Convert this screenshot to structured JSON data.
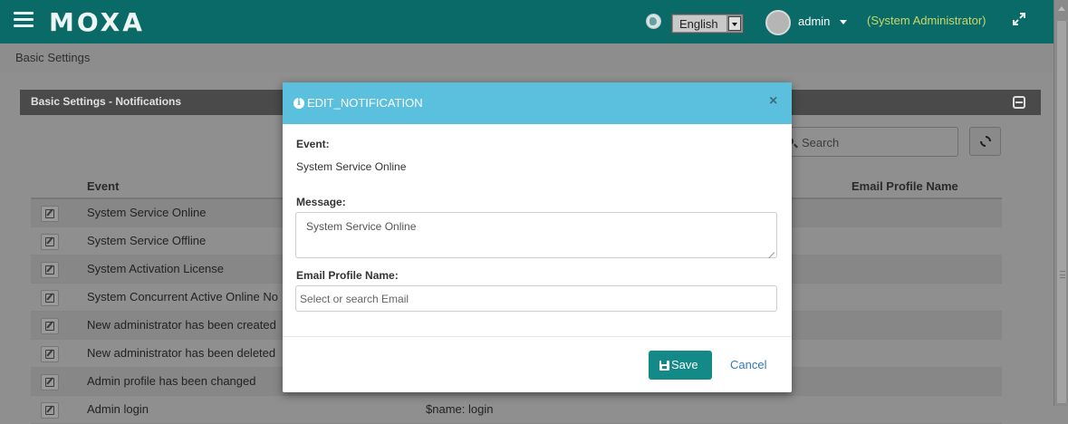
{
  "header": {
    "logo": "MOXA",
    "language": "English",
    "user": "admin",
    "role": "(System Administrator)"
  },
  "breadcrumb": "Basic Settings",
  "panel": {
    "title": "Basic Settings - Notifications",
    "search_placeholder": "Search",
    "columns": {
      "event": "Event",
      "email_profile": "Email Profile Name"
    },
    "rows": [
      {
        "event": "System Service Online",
        "col2": ""
      },
      {
        "event": "System Service Offline",
        "col2": ""
      },
      {
        "event": "System Activation License",
        "col2": ""
      },
      {
        "event": "System Concurrent Active Online No",
        "col2": ""
      },
      {
        "event": "New administrator has been created",
        "col2": ""
      },
      {
        "event": "New administrator has been deleted",
        "col2": ""
      },
      {
        "event": "Admin profile has been changed",
        "col2": ""
      },
      {
        "event": "Admin login",
        "col2": "$name: login"
      }
    ]
  },
  "modal": {
    "title": "EDIT_NOTIFICATION",
    "close": "×",
    "event_label": "Event:",
    "event_value": "System Service Online",
    "message_label": "Message:",
    "message_value": "System Service Online",
    "email_label": "Email Profile Name:",
    "email_placeholder": "Select or search Email",
    "save": "Save",
    "cancel": "Cancel"
  },
  "colors": {
    "topbar": "#0a6a68",
    "modal_header": "#5bc0de",
    "save_button": "#138a87",
    "role_text": "#c7d86a"
  }
}
